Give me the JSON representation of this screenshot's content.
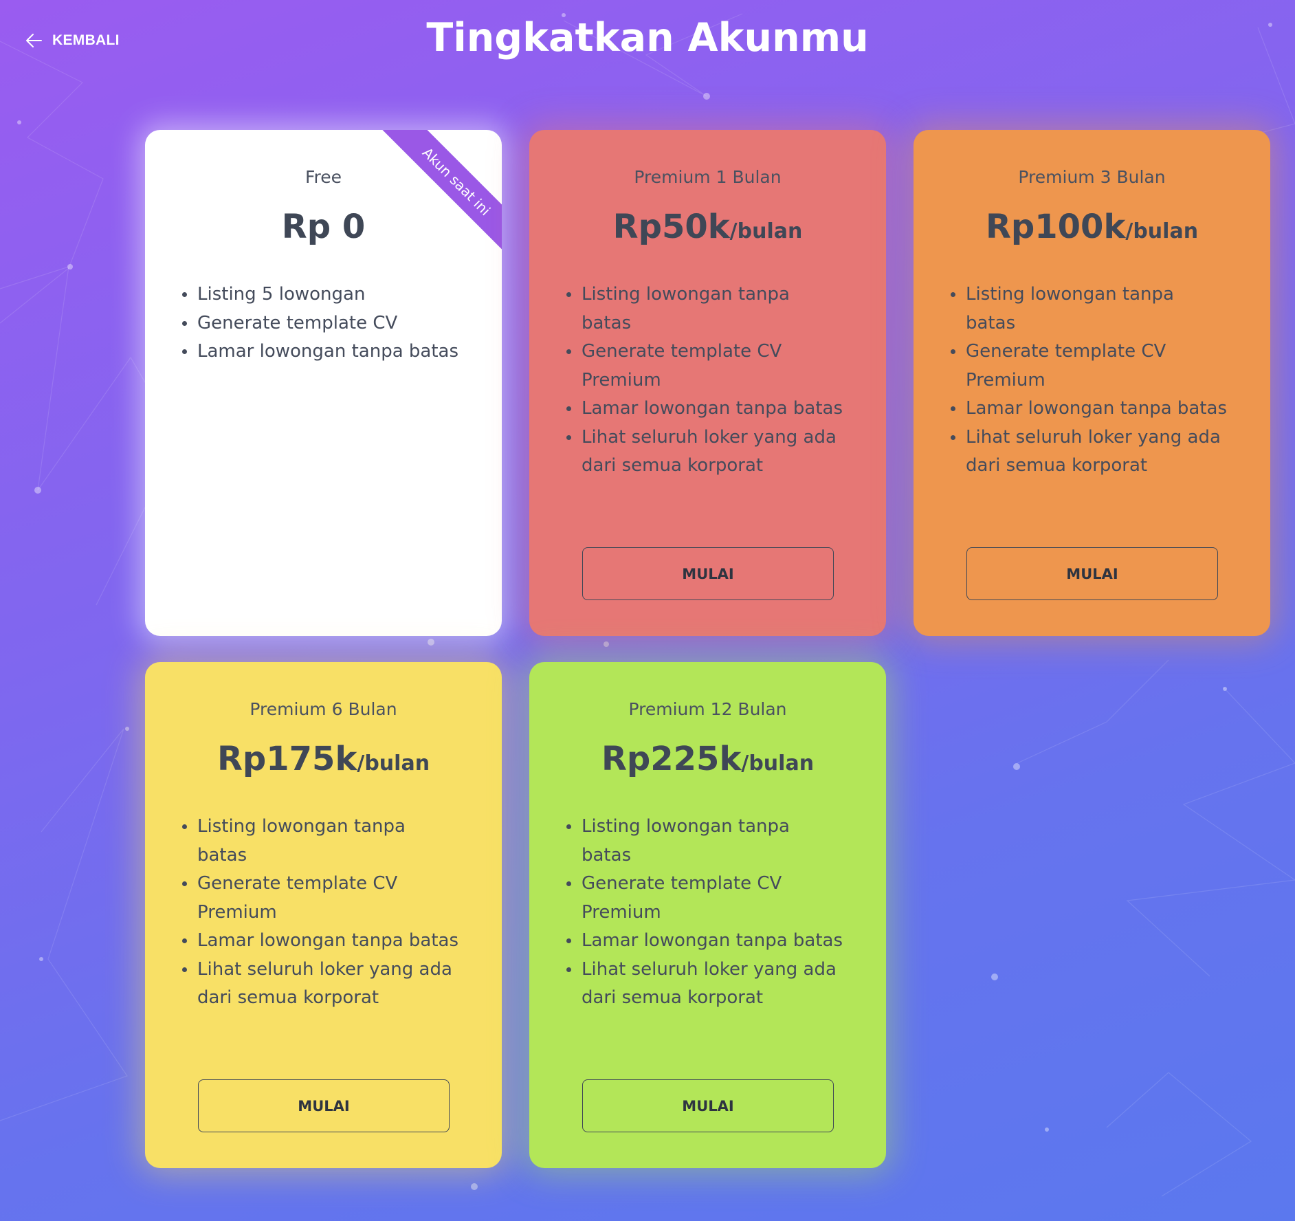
{
  "nav": {
    "back_label": "KEMBALI"
  },
  "page": {
    "title": "Tingkatkan Akunmu"
  },
  "colors": {
    "free": "#ffffff",
    "premium_1": "#e67775",
    "premium_3": "#ee964e",
    "premium_6": "#f8e066",
    "premium_12": "#b3e658",
    "ribbon": "#9a58e6"
  },
  "plans": [
    {
      "name": "Free",
      "price": "Rp 0",
      "per": "",
      "ribbon": "Akun saat ini",
      "features": [
        "Listing 5 lowongan",
        "Generate template CV",
        "Lamar lowongan tanpa batas"
      ]
    },
    {
      "name": "Premium 1 Bulan",
      "price": "Rp50k",
      "per": "/bulan",
      "features": [
        "Listing lowongan tanpa batas",
        "Generate template CV Premium",
        "Lamar lowongan tanpa batas",
        "Lihat seluruh loker yang ada dari semua korporat"
      ],
      "button": "MULAI"
    },
    {
      "name": "Premium 3 Bulan",
      "price": "Rp100k",
      "per": "/bulan",
      "features": [
        "Listing lowongan tanpa batas",
        "Generate template CV Premium",
        "Lamar lowongan tanpa batas",
        "Lihat seluruh loker yang ada dari semua korporat"
      ],
      "button": "MULAI"
    },
    {
      "name": "Premium 6 Bulan",
      "price": "Rp175k",
      "per": "/bulan",
      "features": [
        "Listing lowongan tanpa batas",
        "Generate template CV Premium",
        "Lamar lowongan tanpa batas",
        "Lihat seluruh loker yang ada dari semua korporat"
      ],
      "button": "MULAI"
    },
    {
      "name": "Premium 12 Bulan",
      "price": "Rp225k",
      "per": "/bulan",
      "features": [
        "Listing lowongan tanpa batas",
        "Generate template CV Premium",
        "Lamar lowongan tanpa batas",
        "Lihat seluruh loker yang ada dari semua korporat"
      ],
      "button": "MULAI"
    }
  ]
}
